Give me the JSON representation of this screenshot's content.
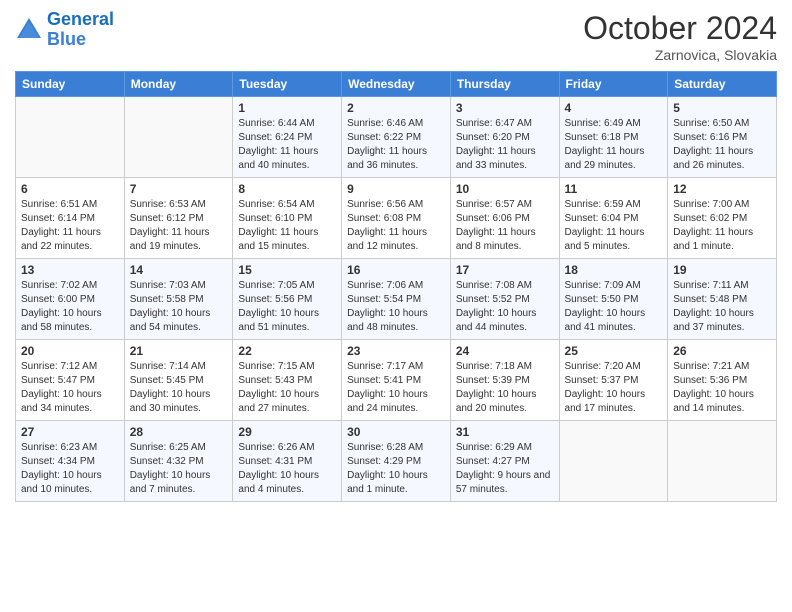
{
  "header": {
    "logo_line1": "General",
    "logo_line2": "Blue",
    "month_year": "October 2024",
    "location": "Zarnovica, Slovakia"
  },
  "weekdays": [
    "Sunday",
    "Monday",
    "Tuesday",
    "Wednesday",
    "Thursday",
    "Friday",
    "Saturday"
  ],
  "weeks": [
    [
      {
        "day": "",
        "sunrise": "",
        "sunset": "",
        "daylight": ""
      },
      {
        "day": "",
        "sunrise": "",
        "sunset": "",
        "daylight": ""
      },
      {
        "day": "1",
        "sunrise": "Sunrise: 6:44 AM",
        "sunset": "Sunset: 6:24 PM",
        "daylight": "Daylight: 11 hours and 40 minutes."
      },
      {
        "day": "2",
        "sunrise": "Sunrise: 6:46 AM",
        "sunset": "Sunset: 6:22 PM",
        "daylight": "Daylight: 11 hours and 36 minutes."
      },
      {
        "day": "3",
        "sunrise": "Sunrise: 6:47 AM",
        "sunset": "Sunset: 6:20 PM",
        "daylight": "Daylight: 11 hours and 33 minutes."
      },
      {
        "day": "4",
        "sunrise": "Sunrise: 6:49 AM",
        "sunset": "Sunset: 6:18 PM",
        "daylight": "Daylight: 11 hours and 29 minutes."
      },
      {
        "day": "5",
        "sunrise": "Sunrise: 6:50 AM",
        "sunset": "Sunset: 6:16 PM",
        "daylight": "Daylight: 11 hours and 26 minutes."
      }
    ],
    [
      {
        "day": "6",
        "sunrise": "Sunrise: 6:51 AM",
        "sunset": "Sunset: 6:14 PM",
        "daylight": "Daylight: 11 hours and 22 minutes."
      },
      {
        "day": "7",
        "sunrise": "Sunrise: 6:53 AM",
        "sunset": "Sunset: 6:12 PM",
        "daylight": "Daylight: 11 hours and 19 minutes."
      },
      {
        "day": "8",
        "sunrise": "Sunrise: 6:54 AM",
        "sunset": "Sunset: 6:10 PM",
        "daylight": "Daylight: 11 hours and 15 minutes."
      },
      {
        "day": "9",
        "sunrise": "Sunrise: 6:56 AM",
        "sunset": "Sunset: 6:08 PM",
        "daylight": "Daylight: 11 hours and 12 minutes."
      },
      {
        "day": "10",
        "sunrise": "Sunrise: 6:57 AM",
        "sunset": "Sunset: 6:06 PM",
        "daylight": "Daylight: 11 hours and 8 minutes."
      },
      {
        "day": "11",
        "sunrise": "Sunrise: 6:59 AM",
        "sunset": "Sunset: 6:04 PM",
        "daylight": "Daylight: 11 hours and 5 minutes."
      },
      {
        "day": "12",
        "sunrise": "Sunrise: 7:00 AM",
        "sunset": "Sunset: 6:02 PM",
        "daylight": "Daylight: 11 hours and 1 minute."
      }
    ],
    [
      {
        "day": "13",
        "sunrise": "Sunrise: 7:02 AM",
        "sunset": "Sunset: 6:00 PM",
        "daylight": "Daylight: 10 hours and 58 minutes."
      },
      {
        "day": "14",
        "sunrise": "Sunrise: 7:03 AM",
        "sunset": "Sunset: 5:58 PM",
        "daylight": "Daylight: 10 hours and 54 minutes."
      },
      {
        "day": "15",
        "sunrise": "Sunrise: 7:05 AM",
        "sunset": "Sunset: 5:56 PM",
        "daylight": "Daylight: 10 hours and 51 minutes."
      },
      {
        "day": "16",
        "sunrise": "Sunrise: 7:06 AM",
        "sunset": "Sunset: 5:54 PM",
        "daylight": "Daylight: 10 hours and 48 minutes."
      },
      {
        "day": "17",
        "sunrise": "Sunrise: 7:08 AM",
        "sunset": "Sunset: 5:52 PM",
        "daylight": "Daylight: 10 hours and 44 minutes."
      },
      {
        "day": "18",
        "sunrise": "Sunrise: 7:09 AM",
        "sunset": "Sunset: 5:50 PM",
        "daylight": "Daylight: 10 hours and 41 minutes."
      },
      {
        "day": "19",
        "sunrise": "Sunrise: 7:11 AM",
        "sunset": "Sunset: 5:48 PM",
        "daylight": "Daylight: 10 hours and 37 minutes."
      }
    ],
    [
      {
        "day": "20",
        "sunrise": "Sunrise: 7:12 AM",
        "sunset": "Sunset: 5:47 PM",
        "daylight": "Daylight: 10 hours and 34 minutes."
      },
      {
        "day": "21",
        "sunrise": "Sunrise: 7:14 AM",
        "sunset": "Sunset: 5:45 PM",
        "daylight": "Daylight: 10 hours and 30 minutes."
      },
      {
        "day": "22",
        "sunrise": "Sunrise: 7:15 AM",
        "sunset": "Sunset: 5:43 PM",
        "daylight": "Daylight: 10 hours and 27 minutes."
      },
      {
        "day": "23",
        "sunrise": "Sunrise: 7:17 AM",
        "sunset": "Sunset: 5:41 PM",
        "daylight": "Daylight: 10 hours and 24 minutes."
      },
      {
        "day": "24",
        "sunrise": "Sunrise: 7:18 AM",
        "sunset": "Sunset: 5:39 PM",
        "daylight": "Daylight: 10 hours and 20 minutes."
      },
      {
        "day": "25",
        "sunrise": "Sunrise: 7:20 AM",
        "sunset": "Sunset: 5:37 PM",
        "daylight": "Daylight: 10 hours and 17 minutes."
      },
      {
        "day": "26",
        "sunrise": "Sunrise: 7:21 AM",
        "sunset": "Sunset: 5:36 PM",
        "daylight": "Daylight: 10 hours and 14 minutes."
      }
    ],
    [
      {
        "day": "27",
        "sunrise": "Sunrise: 6:23 AM",
        "sunset": "Sunset: 4:34 PM",
        "daylight": "Daylight: 10 hours and 10 minutes."
      },
      {
        "day": "28",
        "sunrise": "Sunrise: 6:25 AM",
        "sunset": "Sunset: 4:32 PM",
        "daylight": "Daylight: 10 hours and 7 minutes."
      },
      {
        "day": "29",
        "sunrise": "Sunrise: 6:26 AM",
        "sunset": "Sunset: 4:31 PM",
        "daylight": "Daylight: 10 hours and 4 minutes."
      },
      {
        "day": "30",
        "sunrise": "Sunrise: 6:28 AM",
        "sunset": "Sunset: 4:29 PM",
        "daylight": "Daylight: 10 hours and 1 minute."
      },
      {
        "day": "31",
        "sunrise": "Sunrise: 6:29 AM",
        "sunset": "Sunset: 4:27 PM",
        "daylight": "Daylight: 9 hours and 57 minutes."
      },
      {
        "day": "",
        "sunrise": "",
        "sunset": "",
        "daylight": ""
      },
      {
        "day": "",
        "sunrise": "",
        "sunset": "",
        "daylight": ""
      }
    ]
  ]
}
